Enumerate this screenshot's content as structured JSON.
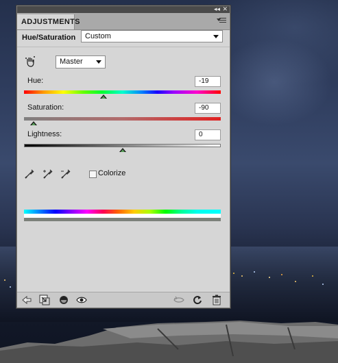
{
  "panel": {
    "tab_label": "ADJUSTMENTS",
    "adjustment_name": "Hue/Saturation",
    "preset": "Custom",
    "channel": "Master",
    "sliders": {
      "hue": {
        "label": "Hue:",
        "value": "-19",
        "position": 0.405
      },
      "saturation": {
        "label": "Saturation:",
        "value": "-90",
        "position": 0.05
      },
      "lightness": {
        "label": "Lightness:",
        "value": "0",
        "position": 0.5
      }
    },
    "colorize": {
      "label": "Colorize",
      "checked": false
    },
    "eyedroppers": [
      "eyedropper-icon",
      "eyedropper-add-icon",
      "eyedropper-subtract-icon"
    ],
    "toolbar_icons_left": [
      "back-arrow-icon",
      "clip-to-layer-icon",
      "visibility-circle-icon",
      "eye-icon"
    ],
    "toolbar_icons_right": [
      "view-previous-icon",
      "reset-icon",
      "trash-icon"
    ]
  },
  "colors": {
    "panel_bg": "#d6d6d6",
    "titlebar": "#4a4a4a",
    "thumb_fill": "#5aa05a"
  }
}
